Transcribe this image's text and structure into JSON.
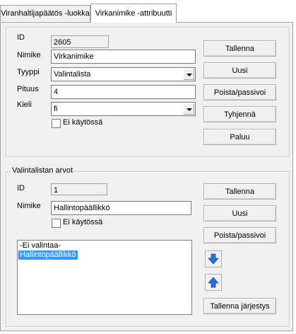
{
  "tabs": [
    {
      "label": "Viranhaltijapäätös -luokka",
      "active": false
    },
    {
      "label": "Virkanimike -attribuutti",
      "active": true
    }
  ],
  "attribute": {
    "id_label": "ID",
    "id_value": "2605",
    "name_label": "Nimike",
    "name_value": "Virkanimike",
    "type_label": "Tyyppi",
    "type_value": "Valintalista",
    "length_label": "Pituus",
    "length_value": "4",
    "language_label": "Kieli",
    "language_value": "fi",
    "disabled_label": "Ei käytössä",
    "buttons": {
      "save": "Tallenna",
      "new": "Uusi",
      "remove": "Poista/passivoi",
      "clear": "Tyhjennä",
      "back": "Paluu"
    }
  },
  "options": {
    "legend": "Valintalistan arvot",
    "id_label": "ID",
    "id_value": "1",
    "name_label": "Nimike",
    "name_value": "Hallintopäällikkö",
    "disabled_label": "Ei käytössä",
    "list_items": [
      "-Ei valintaa-",
      "Hallintopäällikkö"
    ],
    "selected_index": 1,
    "buttons": {
      "save": "Tallenna",
      "new": "Uusi",
      "remove": "Poista/passivoi",
      "move_down_icon": "arrow-down-icon",
      "move_up_icon": "arrow-up-icon",
      "save_order": "Tallenna järjestys"
    }
  },
  "colors": {
    "selection": "#3399ff",
    "arrow_blue": "#2a6fd4"
  }
}
